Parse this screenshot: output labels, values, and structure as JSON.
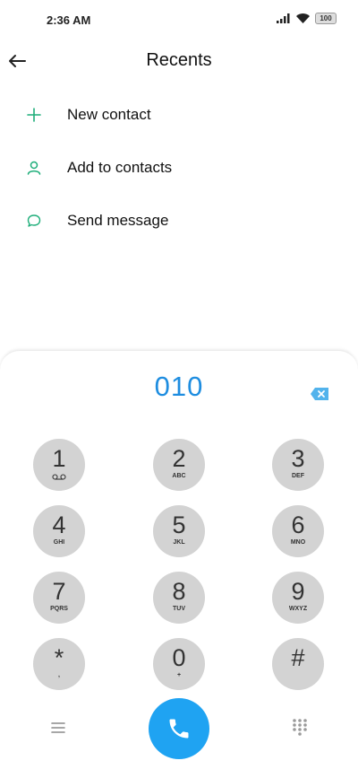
{
  "status": {
    "time": "2:36 AM",
    "battery": "100"
  },
  "header": {
    "title": "Recents"
  },
  "actions": [
    {
      "label": "New contact",
      "icon": "plus-icon"
    },
    {
      "label": "Add to contacts",
      "icon": "person-icon"
    },
    {
      "label": "Send message",
      "icon": "message-bubble-icon"
    }
  ],
  "dialer": {
    "number": "010",
    "keys": [
      {
        "digit": "1",
        "letters": ""
      },
      {
        "digit": "2",
        "letters": "ABC"
      },
      {
        "digit": "3",
        "letters": "DEF"
      },
      {
        "digit": "4",
        "letters": "GHI"
      },
      {
        "digit": "5",
        "letters": "JKL"
      },
      {
        "digit": "6",
        "letters": "MNO"
      },
      {
        "digit": "7",
        "letters": "PQRS"
      },
      {
        "digit": "8",
        "letters": "TUV"
      },
      {
        "digit": "9",
        "letters": "WXYZ"
      },
      {
        "digit": "*",
        "letters": ","
      },
      {
        "digit": "0",
        "letters": "+"
      },
      {
        "digit": "#",
        "letters": ""
      }
    ]
  },
  "colors": {
    "accent": "#1e8de0",
    "call": "#1fa3f2",
    "actionIcon": "#1fae7a",
    "key": "#d3d3d3"
  }
}
